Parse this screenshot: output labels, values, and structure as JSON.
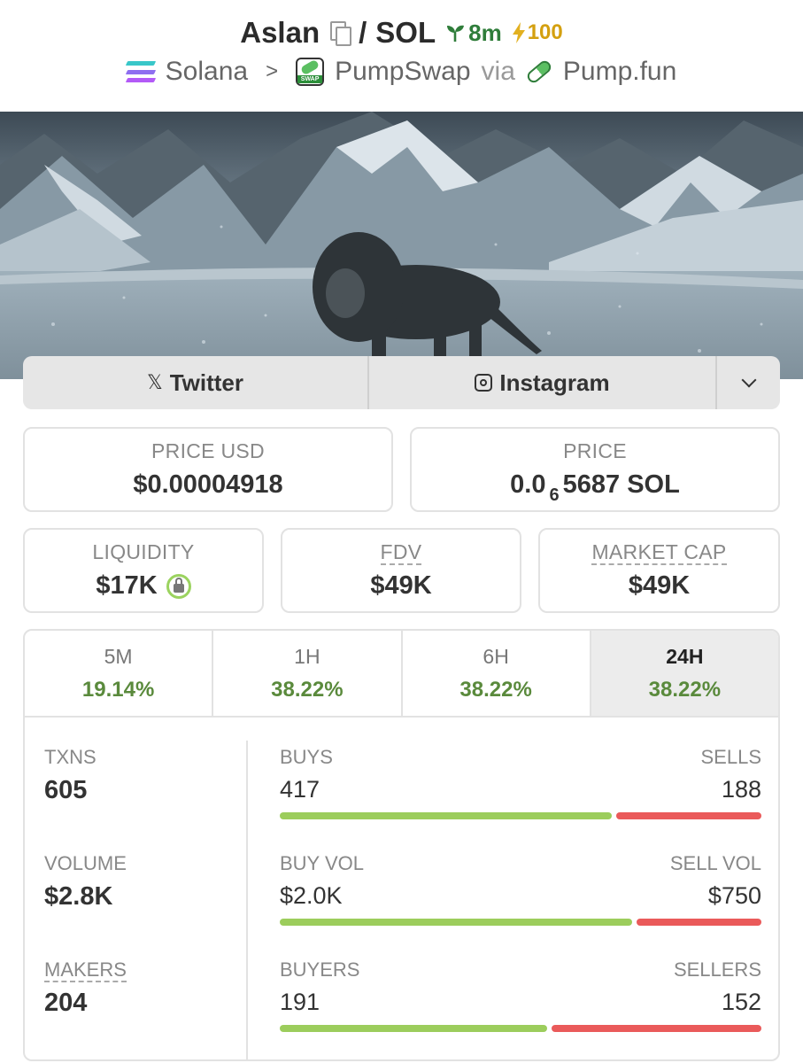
{
  "header": {
    "token_name": "Aslan",
    "separator": "/",
    "quote": "SOL",
    "age": "8m",
    "boost": "100",
    "chain": "Solana",
    "dex": "PumpSwap",
    "via": "via",
    "launchpad": "Pump.fun",
    "icons": [
      "copy-icon",
      "sprout-icon",
      "lightning-icon",
      "solana-logo",
      "pumpswap-logo",
      "pill-icon"
    ]
  },
  "socials": {
    "twitter": "Twitter",
    "instagram": "Instagram",
    "icons": [
      "x-icon",
      "instagram-icon",
      "chevron-down-icon"
    ]
  },
  "prices": {
    "price_usd_label": "PRICE USD",
    "price_usd": "$0.00004918",
    "price_label": "PRICE",
    "price_prefix": "0.0",
    "price_zeros": "6",
    "price_suffix": "5687 SOL"
  },
  "metrics": {
    "liquidity_label": "LIQUIDITY",
    "liquidity": "$17K",
    "fdv_label": "FDV",
    "fdv": "$49K",
    "mcap_label": "MARKET CAP",
    "mcap": "$49K"
  },
  "timeframes": [
    {
      "label": "5M",
      "change": "19.14%"
    },
    {
      "label": "1H",
      "change": "38.22%"
    },
    {
      "label": "6H",
      "change": "38.22%"
    },
    {
      "label": "24H",
      "change": "38.22%",
      "active": true
    }
  ],
  "stats": {
    "txns_label": "TXNS",
    "txns": "605",
    "volume_label": "VOLUME",
    "volume": "$2.8K",
    "makers_label": "MAKERS",
    "makers": "204",
    "buys_label": "BUYS",
    "buys": "417",
    "sells_label": "SELLS",
    "sells": "188",
    "buy_vol_label": "BUY VOL",
    "buy_vol": "$2.0K",
    "sell_vol_label": "SELL VOL",
    "sell_vol": "$750",
    "buyers_label": "BUYERS",
    "buyers": "191",
    "sellers_label": "SELLERS",
    "sellers": "152"
  },
  "colors": {
    "buy": "#9ccd5c",
    "sell": "#ea5a5a",
    "positive": "#5a8a3c",
    "solana_gradient": [
      "#9945FF",
      "#14F195"
    ]
  }
}
